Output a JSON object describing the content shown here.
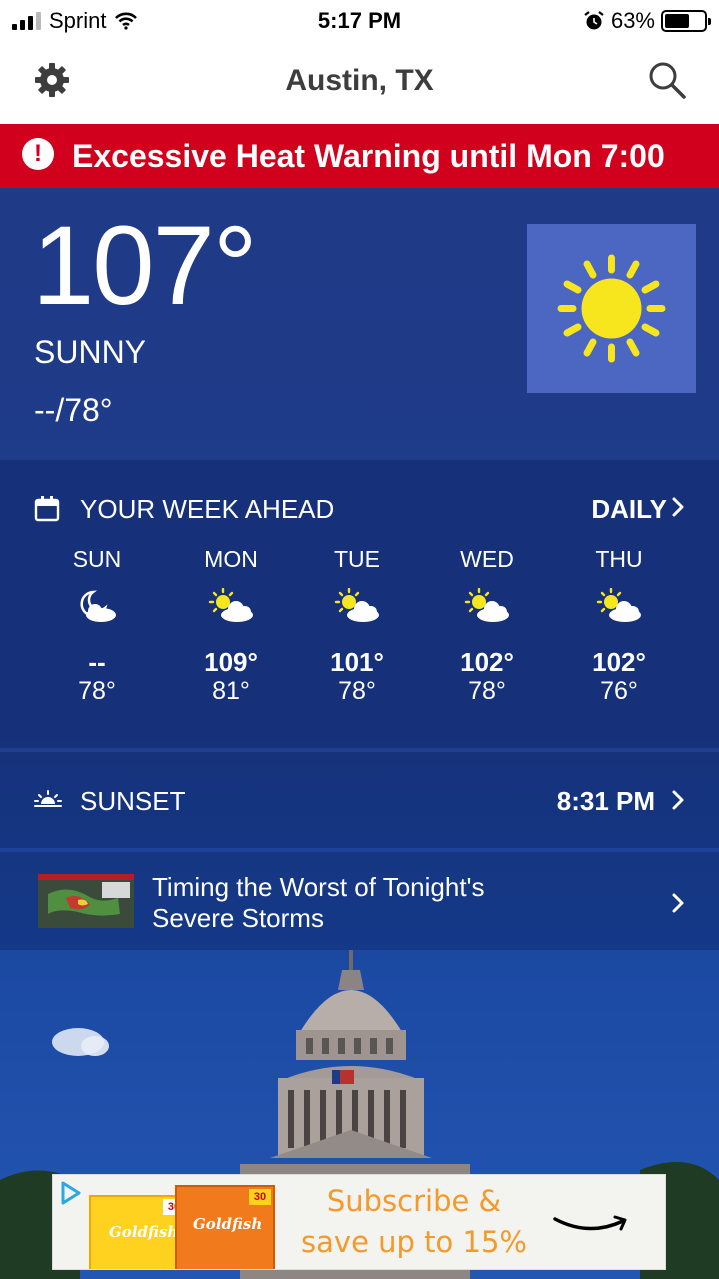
{
  "status_bar": {
    "carrier": "Sprint",
    "time": "5:17 PM",
    "battery": "63%",
    "battery_level": 0.63
  },
  "nav": {
    "title": "Austin, TX",
    "settings_icon": "gear-icon",
    "search_icon": "search-icon"
  },
  "alert": {
    "icon": "exclamation-icon",
    "text": "Excessive Heat Warning until Mon 7:00"
  },
  "current": {
    "temperature": "107°",
    "condition": "SUNNY",
    "hi_lo": "--/78°",
    "icon": "sun-icon"
  },
  "week": {
    "header": "YOUR WEEK AHEAD",
    "daily_link": "DAILY",
    "days": [
      {
        "name": "SUN",
        "icon": "moon-cloud-icon",
        "hi": "--",
        "lo": "78°"
      },
      {
        "name": "MON",
        "icon": "partly-sunny-icon",
        "hi": "109°",
        "lo": "81°"
      },
      {
        "name": "TUE",
        "icon": "partly-sunny-icon",
        "hi": "101°",
        "lo": "78°"
      },
      {
        "name": "WED",
        "icon": "partly-sunny-icon",
        "hi": "102°",
        "lo": "78°"
      },
      {
        "name": "THU",
        "icon": "partly-sunny-icon",
        "hi": "102°",
        "lo": "76°"
      }
    ]
  },
  "sunset": {
    "label": "SUNSET",
    "time": "8:31 PM"
  },
  "story": {
    "headline": "Timing the Worst of Tonight's Severe Storms"
  },
  "ad": {
    "promo": "Subscribe & save up to 15%",
    "brand": "Goldfish",
    "badge": "30"
  },
  "colors": {
    "alert_red": "#d1001c",
    "background_blue": "#1f3a86",
    "sun_yellow": "#f7e51e",
    "sun_box": "#4b67c2",
    "promo_orange": "#f39a2b"
  }
}
